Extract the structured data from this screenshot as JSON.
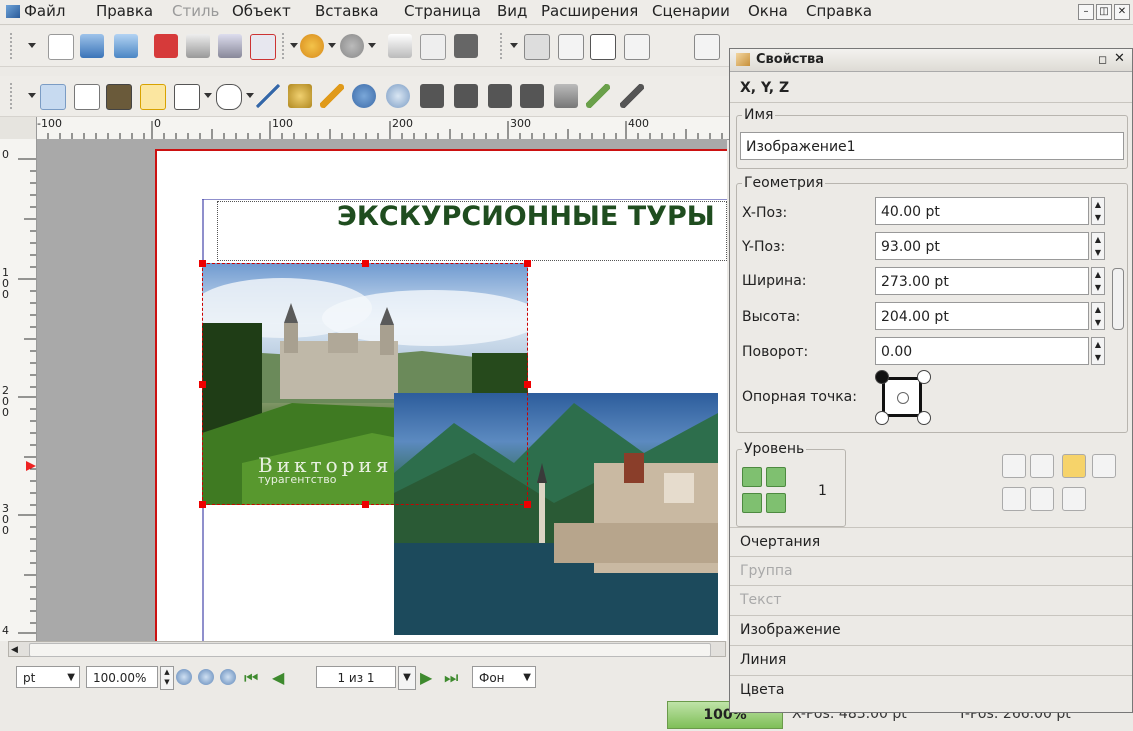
{
  "menu": {
    "items": [
      "Файл",
      "Правка",
      "Стиль",
      "Объект",
      "Вставка",
      "Страница",
      "Вид",
      "Расширения",
      "Сценарии",
      "Окна",
      "Справка"
    ],
    "disabled_index": 2
  },
  "ruler": {
    "h_labels": [
      "-100",
      "0",
      "100",
      "200",
      "300",
      "400"
    ],
    "v_labels": [
      "0",
      "1\n0\n0",
      "2\n0\n0",
      "3\n0\n0",
      "4"
    ]
  },
  "document": {
    "title": "ЭКСКУРСИОННЫЕ ТУРЫ",
    "logo_text": "Виктория",
    "logo_subtext": "турагентство"
  },
  "bottombar": {
    "unit": "pt",
    "zoom": "100.00%",
    "page": "1 из 1",
    "layer": "Фон"
  },
  "statusbar": {
    "zoom_badge": "100%",
    "x_pos": "X-Pos: 483.00 pt",
    "y_pos": "Y-Pos: 266.00 pt"
  },
  "props": {
    "title": "Свойства",
    "xyz_tab": "X, Y, Z",
    "name_group": "Имя",
    "name_value": "Изображение1",
    "geometry_group": "Геометрия",
    "fields": [
      {
        "label": "X-Поз:",
        "value": "40.00 pt"
      },
      {
        "label": "Y-Поз:",
        "value": "93.00 pt"
      },
      {
        "label": "Ширина:",
        "value": "273.00 pt"
      },
      {
        "label": "Высота:",
        "value": "204.00 pt"
      },
      {
        "label": "Поворот:",
        "value": "0.00"
      }
    ],
    "anchor_label": "Опорная точка:",
    "level_group": "Уровень",
    "level_value": "1",
    "sections": [
      {
        "label": "Очертания",
        "enabled": true
      },
      {
        "label": "Группа",
        "enabled": false
      },
      {
        "label": "Текст",
        "enabled": false
      },
      {
        "label": "Изображение",
        "enabled": true
      },
      {
        "label": "Линия",
        "enabled": true
      },
      {
        "label": "Цвета",
        "enabled": true
      }
    ]
  },
  "colors": {
    "page_border": "#cc1111",
    "title_green": "#1f4d1f",
    "selection_handle": "#ee0000"
  }
}
